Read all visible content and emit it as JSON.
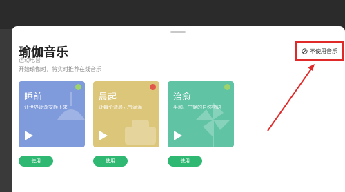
{
  "sheet": {
    "title": "瑜伽音乐",
    "subtitle_ghost": "运动电台",
    "subtitle": "开始瑜伽时，将实时推荐在线音乐"
  },
  "no_music": {
    "label": "不使用音乐",
    "icon": "ban-icon"
  },
  "cards": [
    {
      "name": "睡前",
      "desc": "让世界逐渐安静下来",
      "color": "#7f9bdc",
      "badge": "#9ed26a",
      "button": "使用"
    },
    {
      "name": "晨起",
      "desc": "让每个清晨元气满满",
      "color": "#dcc67a",
      "badge": "#e2574c",
      "button": "使用"
    },
    {
      "name": "治愈",
      "desc": "平和、宁静的自然物语",
      "color": "#5fc3a4",
      "badge": "#9ed26a",
      "button": "使用"
    }
  ],
  "colors": {
    "accent_button": "#2eb872",
    "annotation_red": "#e02a2a"
  }
}
